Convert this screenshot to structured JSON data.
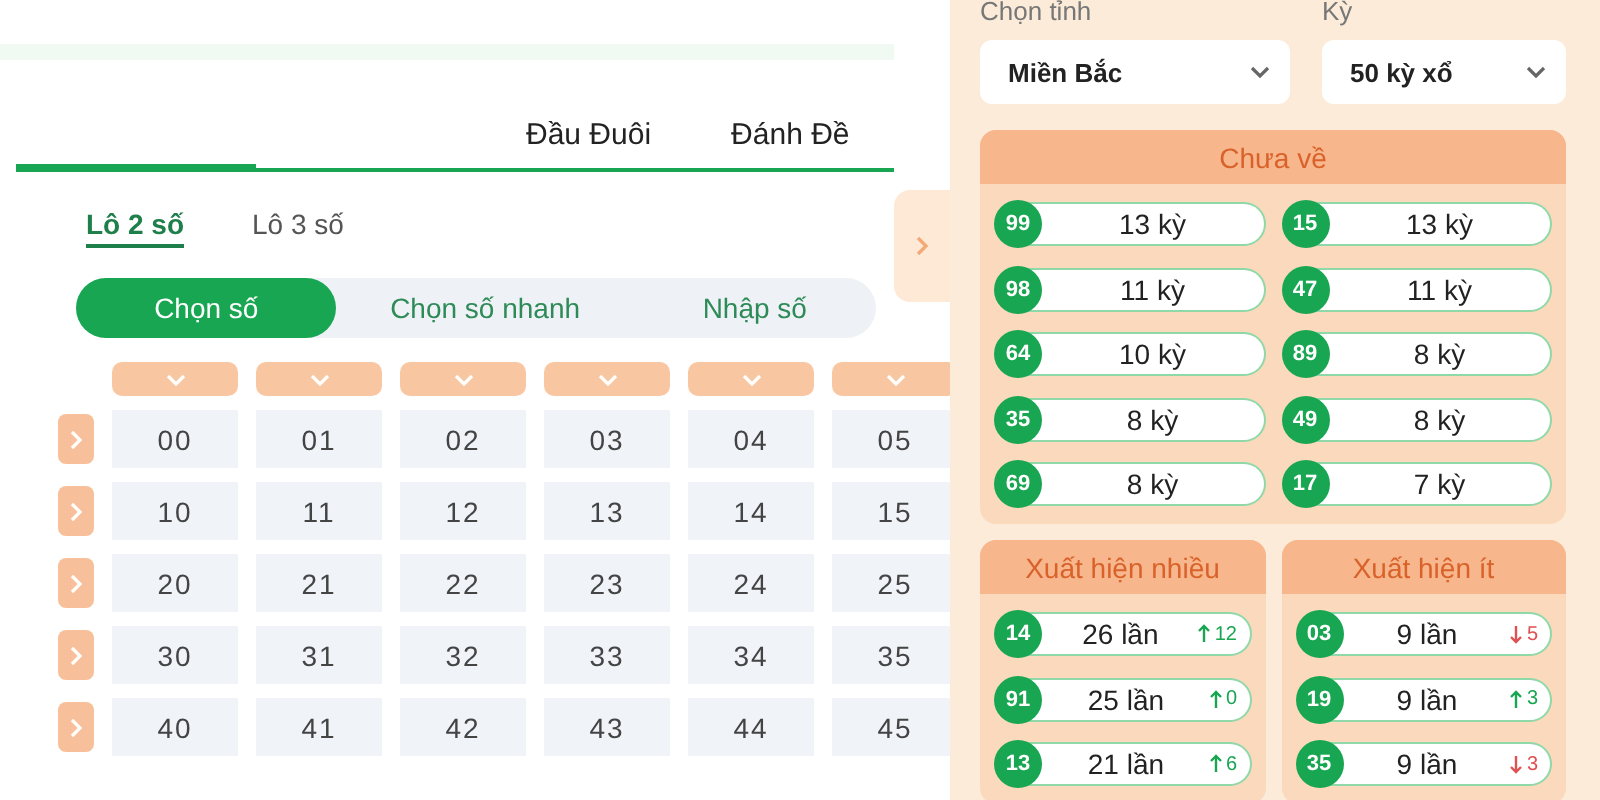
{
  "main_tabs": [
    {
      "label": "Đầu Đuôi",
      "selected": false
    },
    {
      "label": "Đánh Đề",
      "selected": false
    }
  ],
  "sub_tabs": [
    {
      "label": "Lô 2 số",
      "selected": true
    },
    {
      "label": "Lô 3 số",
      "selected": false
    }
  ],
  "modes": [
    {
      "label": "Chọn số",
      "selected": true
    },
    {
      "label": "Chọn số nhanh",
      "selected": false
    },
    {
      "label": "Nhập số",
      "selected": false
    }
  ],
  "number_grid": [
    [
      "00",
      "01",
      "02",
      "03",
      "04",
      "05"
    ],
    [
      "10",
      "11",
      "12",
      "13",
      "14",
      "15"
    ],
    [
      "20",
      "21",
      "22",
      "23",
      "24",
      "25"
    ],
    [
      "30",
      "31",
      "32",
      "33",
      "34",
      "35"
    ],
    [
      "40",
      "41",
      "42",
      "43",
      "44",
      "45"
    ]
  ],
  "filters": [
    {
      "label": "Chọn tỉnh",
      "value": "Miền Bắc"
    },
    {
      "label": "Kỳ",
      "value": "50 kỳ xổ"
    }
  ],
  "not_drawn": {
    "title": "Chưa về",
    "items": [
      {
        "number": "99",
        "count": "13 kỳ"
      },
      {
        "number": "15",
        "count": "13 kỳ"
      },
      {
        "number": "98",
        "count": "11 kỳ"
      },
      {
        "number": "47",
        "count": "11 kỳ"
      },
      {
        "number": "64",
        "count": "10 kỳ"
      },
      {
        "number": "89",
        "count": "8 kỳ"
      },
      {
        "number": "35",
        "count": "8 kỳ"
      },
      {
        "number": "49",
        "count": "8 kỳ"
      },
      {
        "number": "69",
        "count": "8 kỳ"
      },
      {
        "number": "17",
        "count": "7 kỳ"
      }
    ]
  },
  "frequency_cards": [
    {
      "title": "Xuất hiện nhiều",
      "items": [
        {
          "number": "14",
          "count": "26 lần",
          "rising": true,
          "change": "12"
        },
        {
          "number": "91",
          "count": "25 lần",
          "rising": true,
          "change": "0"
        },
        {
          "number": "13",
          "count": "21 lần",
          "rising": true,
          "change": "6"
        }
      ]
    },
    {
      "title": "Xuất hiện ít",
      "items": [
        {
          "number": "03",
          "count": "9 lần",
          "rising": false,
          "change": "5"
        },
        {
          "number": "19",
          "count": "9 lần",
          "rising": true,
          "change": "3"
        },
        {
          "number": "35",
          "count": "9 lần",
          "rising": false,
          "change": "3"
        }
      ]
    }
  ]
}
